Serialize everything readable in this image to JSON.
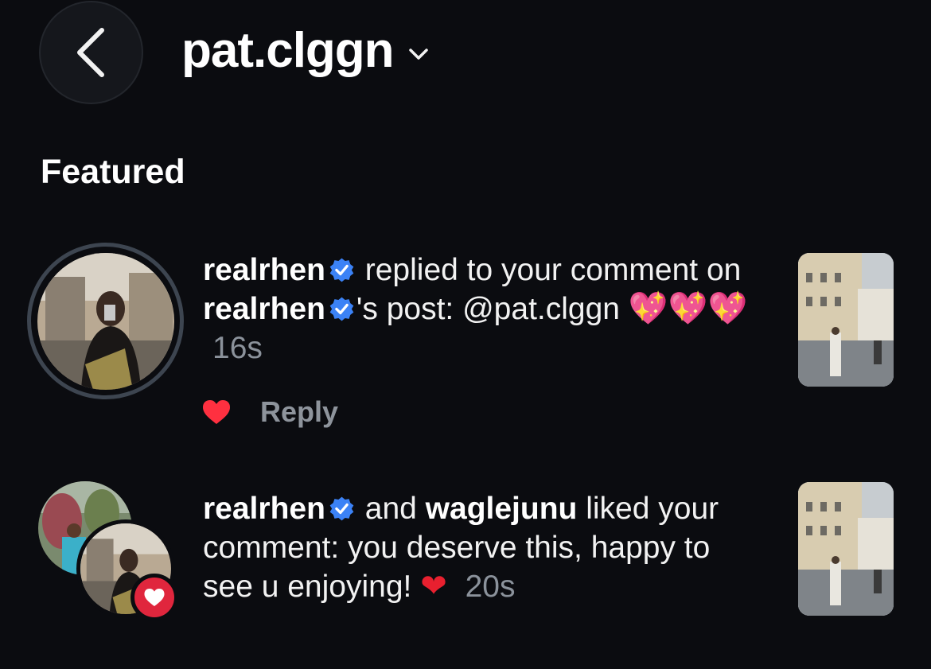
{
  "header": {
    "back_icon": "chevron-left-icon",
    "username": "pat.clggn",
    "dropdown_icon": "chevron-down-icon"
  },
  "section_title": "Featured",
  "notifications": [
    {
      "user1": "realrhen",
      "text1": "replied to your comment on",
      "user2": "realrhen",
      "text2": "'s post:",
      "mention": "@pat.clggn",
      "emoji": "💖💖💖",
      "time": "16s",
      "reply_label": "Reply",
      "like_icon": "heart-icon"
    },
    {
      "user1": "realrhen",
      "text1": "and",
      "user2": "waglejunu",
      "text2": "liked your comment: you deserve this, happy to see u enjoying!",
      "emoji": "❤",
      "time": "20s",
      "badge_icon": "heart-icon"
    }
  ],
  "colors": {
    "background": "#0b0c10",
    "verified": "#3b82f6",
    "like_red": "#e0263d",
    "muted": "#8b929b"
  }
}
